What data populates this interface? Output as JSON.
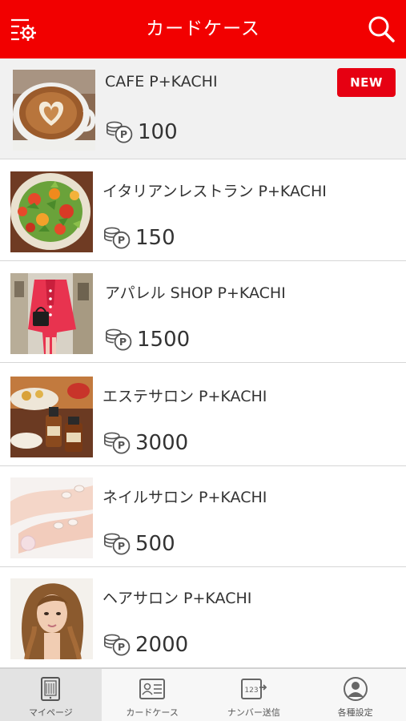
{
  "header": {
    "title": "カードケース"
  },
  "cards": [
    {
      "name": "CAFE P+KACHI",
      "points": "100",
      "badge": "NEW"
    },
    {
      "name": "イタリアンレストラン P+KACHI",
      "points": "150"
    },
    {
      "name": "アパレル SHOP P+KACHI",
      "points": "1500"
    },
    {
      "name": "エステサロン P+KACHI",
      "points": "3000"
    },
    {
      "name": "ネイルサロン P+KACHI",
      "points": "500"
    },
    {
      "name": "ヘアサロン P+KACHI",
      "points": "2000"
    }
  ],
  "tabs": [
    {
      "label": "マイページ",
      "icon": "tablet-icon",
      "active": true
    },
    {
      "label": "カードケース",
      "icon": "card-icon"
    },
    {
      "label": "ナンバー送信",
      "icon": "number-send-icon"
    },
    {
      "label": "各種設定",
      "icon": "user-settings-icon"
    }
  ],
  "colors": {
    "brand": "#f20000",
    "badge": "#e60012"
  }
}
